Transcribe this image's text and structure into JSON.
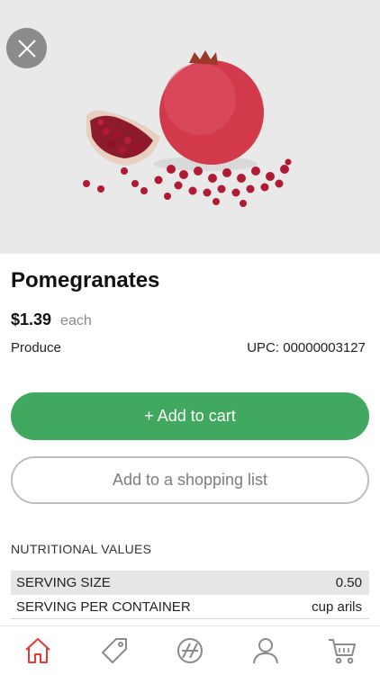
{
  "product": {
    "name": "Pomegranates",
    "price": "$1.39",
    "unit": "each",
    "category": "Produce",
    "upc": "UPC: 00000003127",
    "image_icon": "pomegranate-photo"
  },
  "actions": {
    "add_to_cart": "+ Add to cart",
    "add_to_list": "Add to a shopping list"
  },
  "nutrition": {
    "heading": "NUTRITIONAL VALUES",
    "rows": [
      {
        "label": "SERVING SIZE",
        "value": "0.50"
      },
      {
        "label": "SERVING PER CONTAINER",
        "value": "cup arils"
      }
    ]
  },
  "tabbar": {
    "items": [
      {
        "icon": "home-icon",
        "active": true
      },
      {
        "icon": "tag-icon",
        "active": false
      },
      {
        "icon": "compass-icon",
        "active": false
      },
      {
        "icon": "user-icon",
        "active": false
      },
      {
        "icon": "cart-icon",
        "active": false
      }
    ]
  },
  "colors": {
    "accent_green": "#41a85f",
    "active_tab_red": "#e53935",
    "inactive_icon": "#8a8a8a",
    "hero_bg": "#e9e9ea"
  }
}
